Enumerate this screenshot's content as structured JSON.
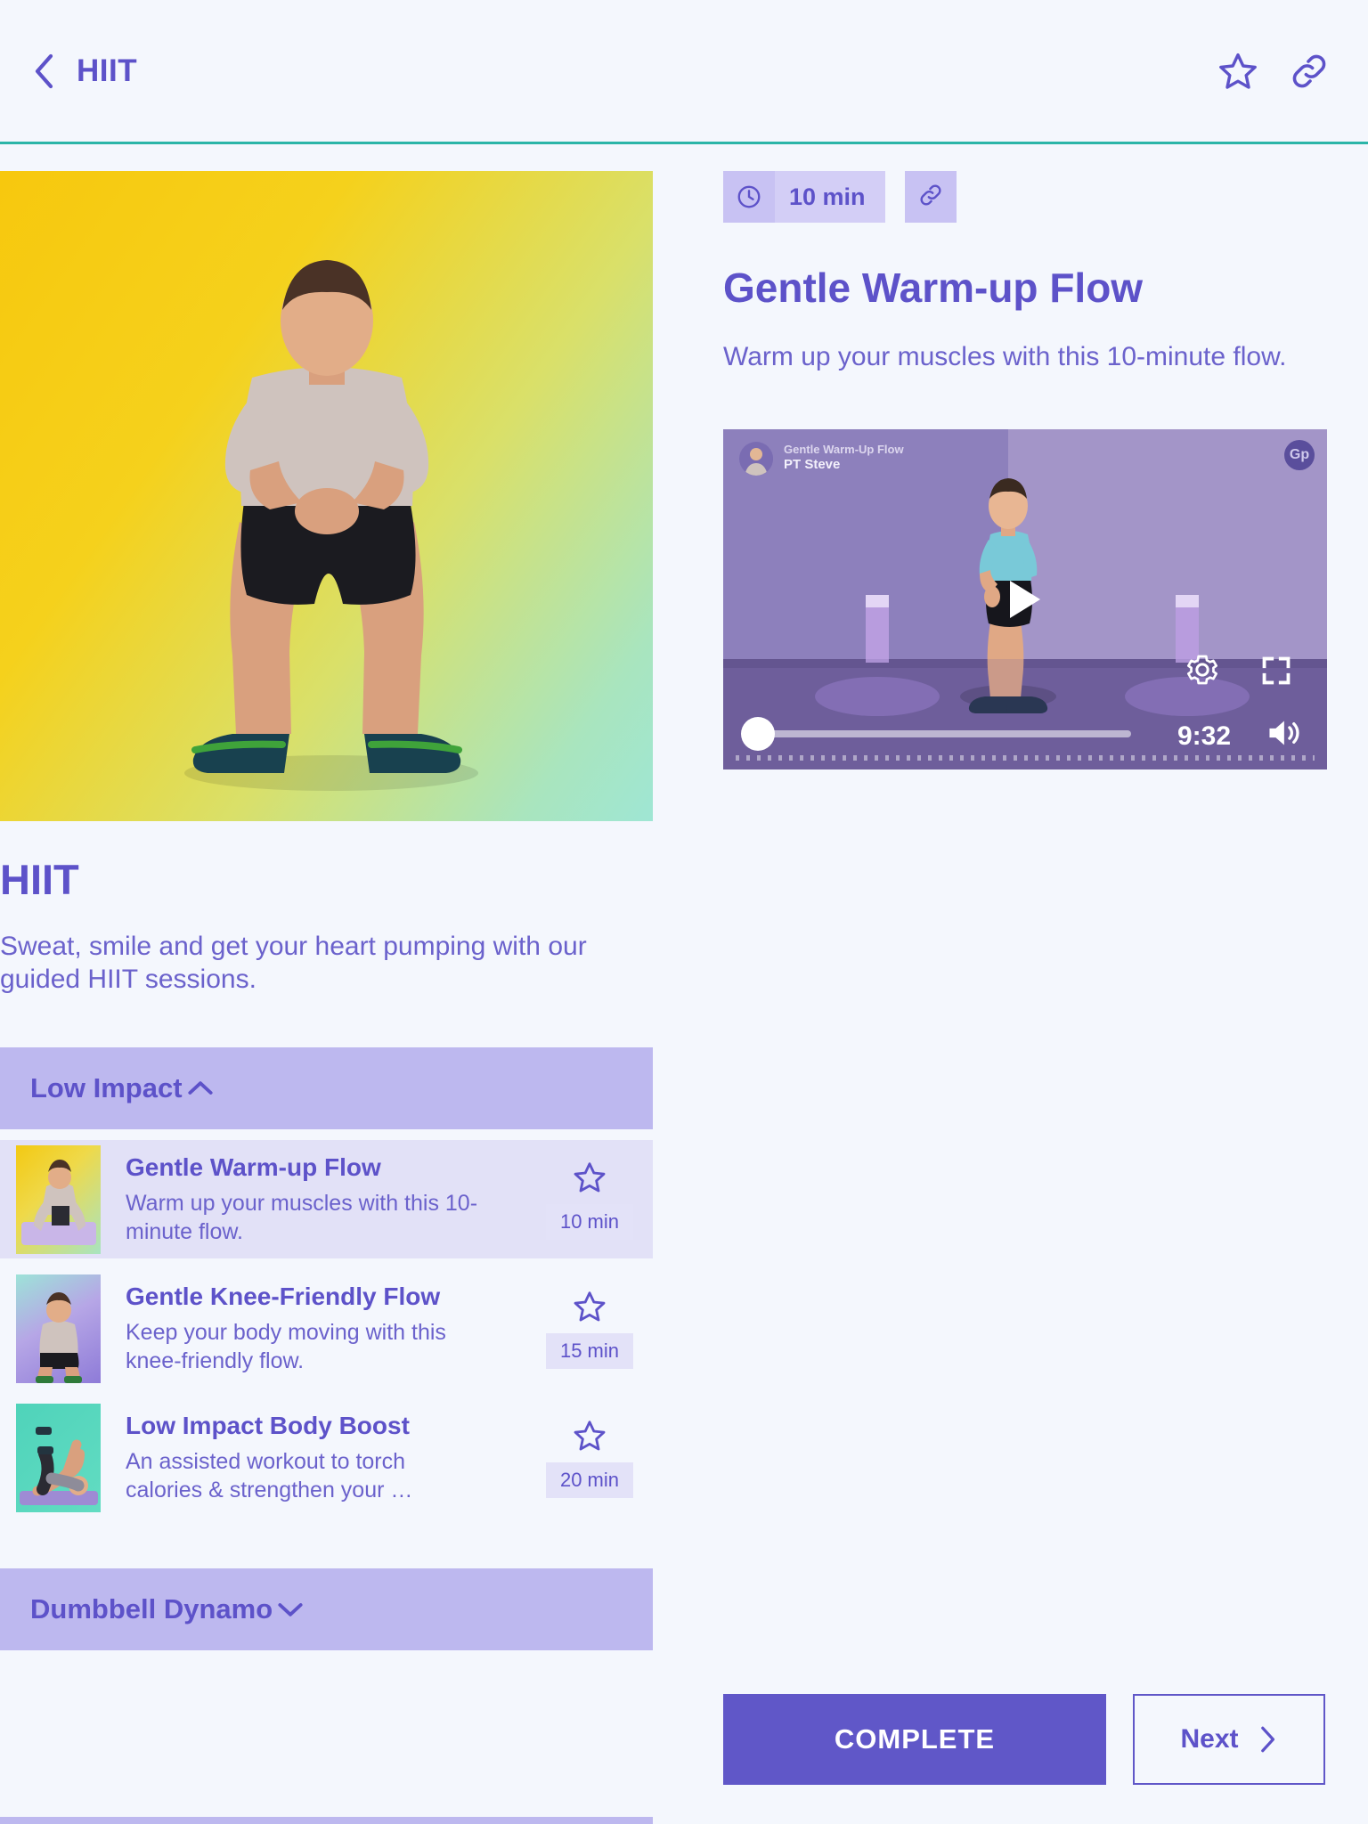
{
  "topbar": {
    "back_icon": "chevron-left-icon",
    "title": "HIIT",
    "favorite_icon": "star-outline-icon",
    "share_icon": "link-icon"
  },
  "category": {
    "title": "HIIT",
    "description": "Sweat, smile and get your heart pumping with our guided HIIT sessions.",
    "hero_alt": "man-performing-squat"
  },
  "lesson": {
    "duration_label": "10 min",
    "clock_icon": "clock-icon",
    "link_icon": "link-icon",
    "title": "Gentle Warm-up Flow",
    "description": "Warm up your muscles with this 10-minute flow."
  },
  "video": {
    "overlay_title": "Gentle Warm-Up Flow",
    "overlay_author": "PT Steve",
    "logo_text": "Gp",
    "play_icon": "play-icon",
    "settings_icon": "gear-icon",
    "fullscreen_icon": "fullscreen-icon",
    "volume_icon": "volume-icon",
    "time_remaining": "9:32",
    "progress_percent": 0
  },
  "sections": [
    {
      "label": "Low Impact",
      "expanded": true,
      "caret_icon": "chevron-up-icon",
      "items": [
        {
          "title": "Gentle Warm-up Flow",
          "description": "Warm up your muscles with this 10-minute flow.",
          "duration": "10 min",
          "star_icon": "star-outline-icon",
          "active": true,
          "thumb": "t1"
        },
        {
          "title": "Gentle Knee-Friendly Flow",
          "description": "Keep your body moving with this knee-friendly flow.",
          "duration": "15 min",
          "star_icon": "star-outline-icon",
          "active": false,
          "thumb": "t2"
        },
        {
          "title": "Low Impact Body Boost",
          "description": "An assisted workout to torch calories & strengthen your …",
          "duration": "20 min",
          "star_icon": "star-outline-icon",
          "active": false,
          "thumb": "t3"
        }
      ]
    },
    {
      "label": "Dumbbell Dynamo",
      "expanded": false,
      "caret_icon": "chevron-down-icon",
      "items": []
    }
  ],
  "actions": {
    "complete_label": "COMPLETE",
    "next_label": "Next",
    "next_icon": "chevron-right-icon"
  },
  "colors": {
    "page_bg": "#F4F7FD",
    "accent": "#5D52C9",
    "button": "#6057C8",
    "accordion_bg": "#BDB8EF",
    "chip_bg": "#E3E2F8",
    "row_active_bg": "#E2E1F7",
    "rule_teal": "#2BB5A8",
    "pill_bg": "#D3CEF6",
    "pill_icon_bg": "#C8C2F3"
  }
}
